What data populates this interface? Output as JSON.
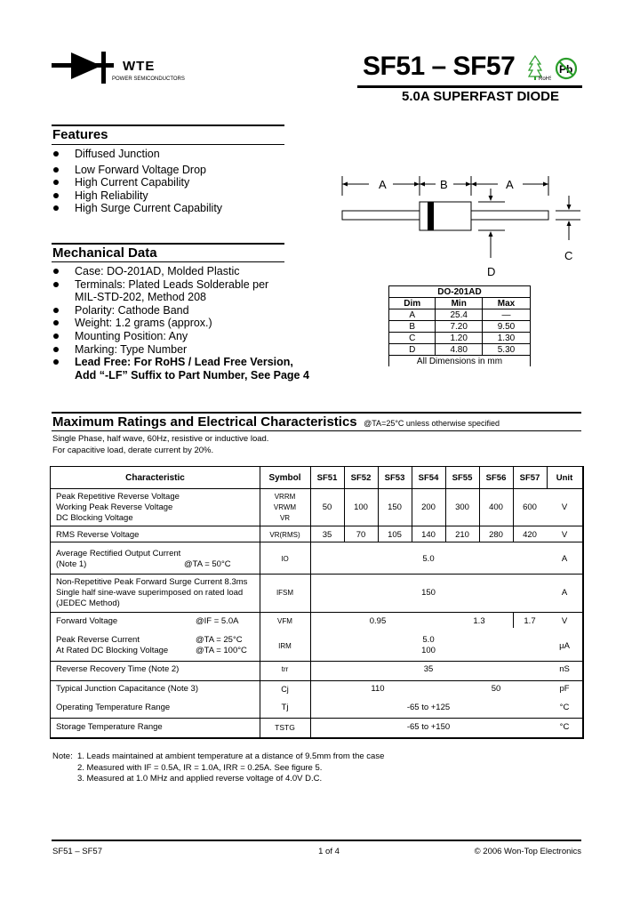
{
  "header": {
    "brand": "WTE",
    "brand_sub": "POWER SEMICONDUCTORS",
    "part_range": "SF51 – SF57",
    "rohs_label": "RoHS",
    "pb_label": "Pb",
    "subtitle": "5.0A SUPERFAST DIODE"
  },
  "features": {
    "title": "Features",
    "items": [
      "Diffused Junction",
      "Low Forward Voltage Drop",
      "High Current Capability",
      "High Reliability",
      "High Surge Current Capability"
    ]
  },
  "diagram": {
    "labels": {
      "a_left": "A",
      "b": "B",
      "a_right": "A",
      "c": "C",
      "d": "D"
    }
  },
  "mechanical": {
    "title": "Mechanical Data",
    "items": [
      {
        "text": "Case: DO-201AD, Molded Plastic",
        "bold": false
      },
      {
        "text": "Terminals: Plated Leads Solderable per",
        "cont": "MIL-STD-202, Method 208",
        "bold": false
      },
      {
        "text": "Polarity: Cathode Band",
        "bold": false
      },
      {
        "text": "Weight: 1.2 grams (approx.)",
        "bold": false
      },
      {
        "text": "Mounting Position: Any",
        "bold": false
      },
      {
        "text": "Marking: Type Number",
        "bold": false
      },
      {
        "text": "Lead Free: For RoHS / Lead Free Version,",
        "cont": "Add “-LF” Suffix to Part Number, See Page 4",
        "bold": true
      }
    ]
  },
  "dimensions": {
    "package": "DO-201AD",
    "headers": [
      "Dim",
      "Min",
      "Max"
    ],
    "rows": [
      [
        "A",
        "25.4",
        "—"
      ],
      [
        "B",
        "7.20",
        "9.50"
      ],
      [
        "C",
        "1.20",
        "1.30"
      ],
      [
        "D",
        "4.80",
        "5.30"
      ]
    ],
    "footer": "All Dimensions in mm"
  },
  "ratings": {
    "title": "Maximum Ratings and Electrical Characteristics",
    "condition": "@TA=25°C unless otherwise specified",
    "note_line1": "Single Phase, half wave, 60Hz, resistive or inductive load.",
    "note_line2": "For capacitive load, derate current by 20%.",
    "headers": [
      "Characteristic",
      "Symbol",
      "SF51",
      "SF52",
      "SF53",
      "SF54",
      "SF55",
      "SF56",
      "SF57",
      "Unit"
    ],
    "rows": {
      "vrrm": {
        "char": [
          "Peak Repetitive Reverse Voltage",
          "Working Peak Reverse Voltage",
          "DC Blocking Voltage"
        ],
        "sym": [
          "VRRM",
          "VRWM",
          "VR"
        ],
        "values": [
          "50",
          "100",
          "150",
          "200",
          "300",
          "400",
          "600"
        ],
        "unit": "V"
      },
      "vrms": {
        "char": "RMS Reverse Voltage",
        "sym": "VR(RMS)",
        "values": [
          "35",
          "70",
          "105",
          "140",
          "210",
          "280",
          "420"
        ],
        "unit": "V"
      },
      "io": {
        "char": [
          "Average Rectified Output Current",
          "(Note 1)"
        ],
        "cond": "@TA = 50°C",
        "sym": "IO",
        "value": "5.0",
        "unit": "A"
      },
      "ifsm": {
        "char": [
          "Non-Repetitive Peak Forward Surge Current 8.3ms",
          "Single half sine-wave superimposed on rated load",
          "(JEDEC Method)"
        ],
        "sym": "IFSM",
        "value": "150",
        "unit": "A"
      },
      "vfm": {
        "char": "Forward Voltage",
        "cond": "@IF = 5.0A",
        "sym": "VFM",
        "value_a": "0.95",
        "value_b": "1.3",
        "value_c": "1.7",
        "unit": "V"
      },
      "irm": {
        "char": [
          "Peak Reverse Current",
          "At Rated DC Blocking Voltage"
        ],
        "cond": [
          "@TA = 25°C",
          "@TA = 100°C"
        ],
        "sym": "IRM",
        "value": [
          "5.0",
          "100"
        ],
        "unit": "µA"
      },
      "trr": {
        "char": "Reverse Recovery Time (Note 2)",
        "sym": "trr",
        "value": "35",
        "unit": "nS"
      },
      "cj": {
        "char": "Typical Junction Capacitance (Note 3)",
        "sym": "Cj",
        "value_a": "110",
        "value_b": "50",
        "unit": "pF"
      },
      "tj": {
        "char": "Operating Temperature Range",
        "sym": "Tj",
        "value": "-65 to +125",
        "unit": "°C"
      },
      "tstg": {
        "char": "Storage Temperature Range",
        "sym": "TSTG",
        "value": "-65 to +150",
        "unit": "°C"
      }
    }
  },
  "notes": {
    "label": "Note:",
    "items": [
      "1. Leads maintained at ambient temperature at a distance of 9.5mm from the case",
      "2. Measured with IF = 0.5A, IR = 1.0A, IRR = 0.25A. See figure 5.",
      "3. Measured at 1.0 MHz and applied reverse voltage of 4.0V D.C."
    ]
  },
  "footer": {
    "left": "SF51 – SF57",
    "center": "1 of 4",
    "right": "© 2006 Won-Top Electronics"
  }
}
